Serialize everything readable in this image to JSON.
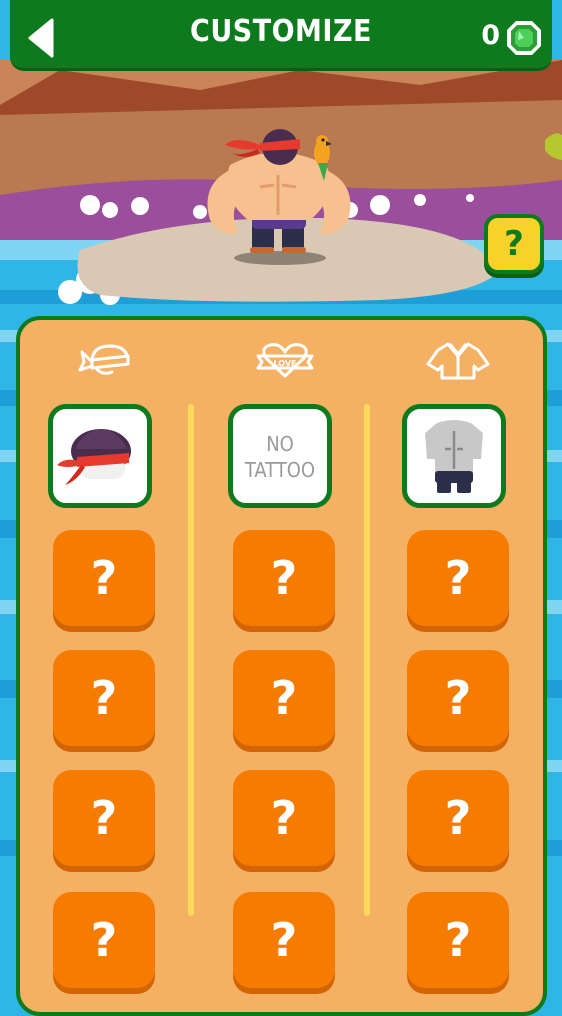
{
  "header": {
    "title": "CUSTOMIZE",
    "gem_count": "0"
  },
  "help_button": {
    "label": "?"
  },
  "categories": [
    {
      "icon": "headband-icon"
    },
    {
      "icon": "love-tattoo-icon"
    },
    {
      "icon": "shirt-icon"
    }
  ],
  "columns": [
    {
      "selected_item": "headband-item",
      "locked_label": "?"
    },
    {
      "selected_item": "no-tattoo-item",
      "selected_text": "NO TATTOO",
      "locked_label": "?"
    },
    {
      "selected_item": "outfit-item",
      "locked_label": "?"
    }
  ],
  "tattoo_banner": "LOVE",
  "colors": {
    "header_green": "#0d7a1e",
    "panel_orange": "#f5b163",
    "locked_orange": "#f57c00",
    "help_yellow": "#f6d22a"
  }
}
